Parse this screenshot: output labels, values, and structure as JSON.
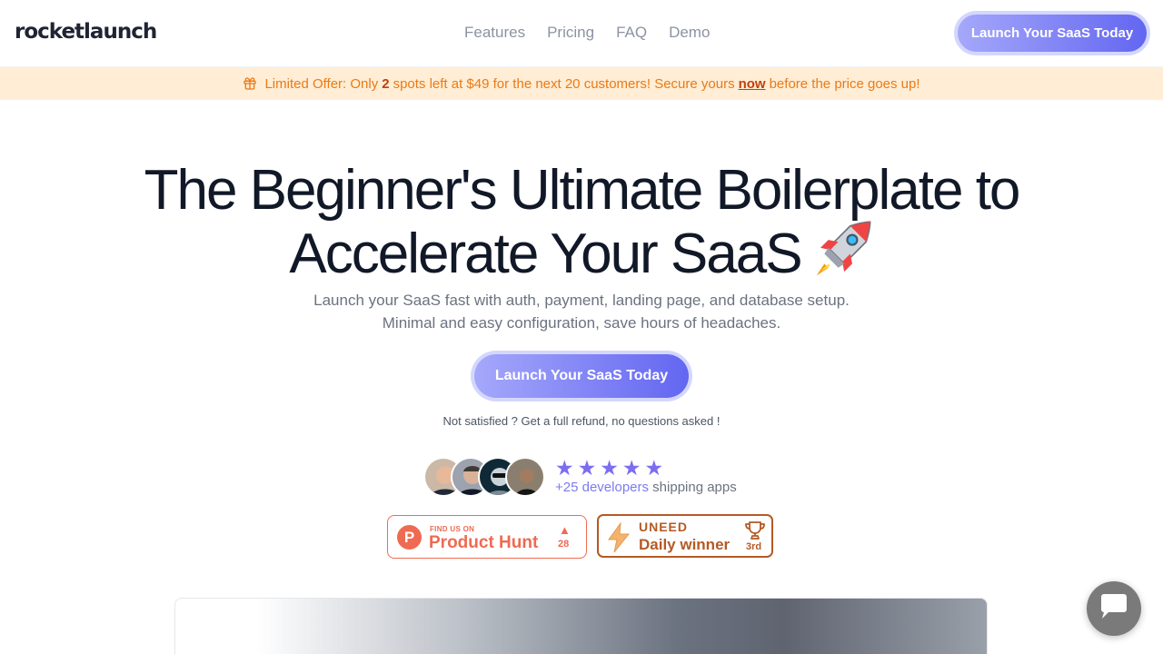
{
  "header": {
    "logo": "rocketlaunch",
    "nav": [
      "Features",
      "Pricing",
      "FAQ",
      "Demo"
    ],
    "cta": "Launch Your SaaS Today"
  },
  "banner": {
    "icon": "gift-icon",
    "text_before": "Limited Offer: Only",
    "spots": "2",
    "text_middle": "spots left at $49 for the next 20 customers! Secure yours",
    "link": "now",
    "text_after": "before the price goes up!"
  },
  "hero": {
    "title_line1": "The Beginner's Ultimate Boilerplate to",
    "title_line2": "Accelerate Your SaaS",
    "title_icon": "rocket-emoji",
    "subtitle_line1": "Launch your SaaS fast with auth, payment, landing page, and database setup.",
    "subtitle_line2": "Minimal and easy configuration, save hours of headaches.",
    "cta": "Launch Your SaaS Today",
    "refund": "Not satisfied ? Get a full refund, no questions asked !"
  },
  "social_proof": {
    "rating": 5,
    "rating_max": 5,
    "highlight": "+25 developers",
    "rest": "shipping apps"
  },
  "badges": {
    "product_hunt": {
      "small": "FIND US ON",
      "name": "Product Hunt",
      "count": "28",
      "logo_letter": "P"
    },
    "uneed": {
      "name": "UNEED",
      "subtitle": "Daily winner",
      "rank": "3rd"
    }
  },
  "colors": {
    "accent": "#6366f1",
    "banner_bg": "#ffedd5",
    "banner_text": "#ea7a16",
    "product_hunt": "#ef6a52",
    "uneed": "#b45a24"
  },
  "chat": {
    "icon": "chat-bubble-icon"
  }
}
